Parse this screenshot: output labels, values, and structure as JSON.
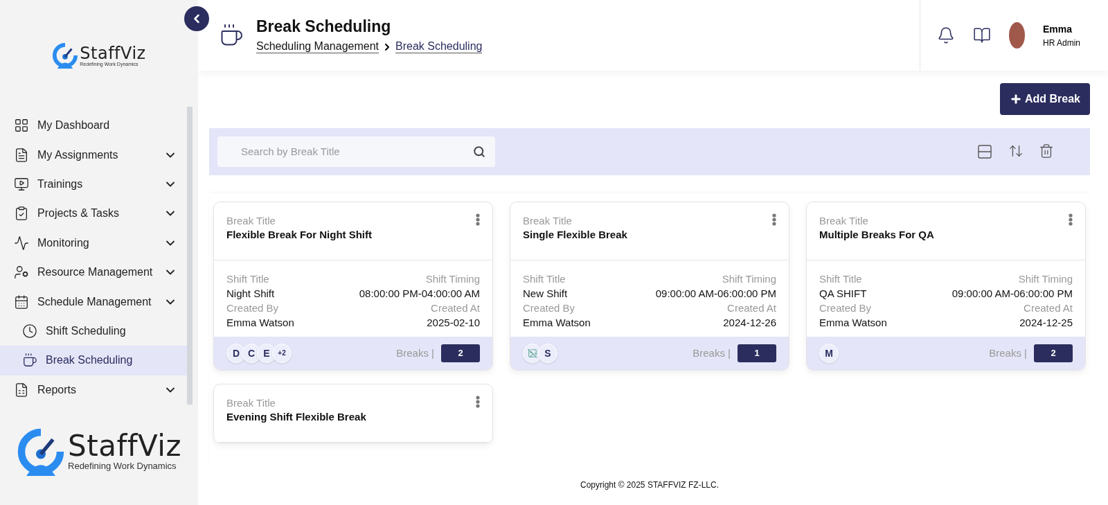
{
  "sidebar": {
    "logo": {
      "name": "StaffViz",
      "tagline": "Redefining Work Dynamics"
    },
    "items": [
      {
        "label": "My Dashboard",
        "expandable": false,
        "selected": false
      },
      {
        "label": "My Assignments",
        "expandable": true,
        "selected": false
      },
      {
        "label": "Trainings",
        "expandable": true,
        "selected": false
      },
      {
        "label": "Projects & Tasks",
        "expandable": true,
        "selected": false
      },
      {
        "label": "Monitoring",
        "expandable": true,
        "selected": false
      },
      {
        "label": "Resource Management",
        "expandable": true,
        "selected": false
      },
      {
        "label": "Schedule Management",
        "expandable": true,
        "selected": false,
        "children": [
          {
            "label": "Shift Scheduling",
            "selected": false
          },
          {
            "label": "Break Scheduling",
            "selected": true
          }
        ]
      },
      {
        "label": "Reports",
        "expandable": true,
        "selected": false
      }
    ],
    "footer_logo": {
      "name": "StaffViz",
      "tagline": "Redefining Work Dynamics"
    }
  },
  "header": {
    "title": "Break Scheduling",
    "breadcrumb": [
      "Scheduling Management",
      "Break Scheduling"
    ],
    "user": {
      "name": "Emma",
      "role": "HR Admin"
    }
  },
  "toolbar": {
    "add_button": "Add Break",
    "search": {
      "placeholder": "Search by Break Title"
    }
  },
  "cards": [
    {
      "title_label": "Break Title",
      "title": "Flexible Break For Night Shift",
      "shift_title_label": "Shift Title",
      "shift_title": "Night Shift",
      "timing_label": "Shift Timing",
      "timing": "08:00:00 PM-04:00:00 AM",
      "created_by_label": "Created By",
      "created_by": "Emma Watson",
      "created_at_label": "Created At",
      "created_at": "2025-02-10",
      "avatars": [
        {
          "kind": "initial",
          "text": "D"
        },
        {
          "kind": "initial",
          "text": "C"
        },
        {
          "kind": "initial",
          "text": "E"
        },
        {
          "kind": "more",
          "text": "+2"
        }
      ],
      "breaks_label": "Breaks |",
      "breaks": "2"
    },
    {
      "title_label": "Break Title",
      "title": "Single Flexible Break",
      "shift_title_label": "Shift Title",
      "shift_title": "New Shift",
      "timing_label": "Shift Timing",
      "timing": "09:00:00 AM-06:00:00 PM",
      "created_by_label": "Created By",
      "created_by": "Emma Watson",
      "created_at_label": "Created At",
      "created_at": "2024-12-26",
      "avatars": [
        {
          "kind": "broken-image"
        },
        {
          "kind": "initial",
          "text": "S"
        }
      ],
      "breaks_label": "Breaks |",
      "breaks": "1"
    },
    {
      "title_label": "Break Title",
      "title": "Multiple Breaks For QA",
      "shift_title_label": "Shift Title",
      "shift_title": "QA SHIFT",
      "timing_label": "Shift Timing",
      "timing": "09:00:00 AM-06:00:00 PM",
      "created_by_label": "Created By",
      "created_by": "Emma Watson",
      "created_at_label": "Created At",
      "created_at": "2024-12-25",
      "avatars": [
        {
          "kind": "initial",
          "text": "M"
        }
      ],
      "breaks_label": "Breaks |",
      "breaks": "2"
    },
    {
      "title_label": "Break Title",
      "title": "Evening Shift Flexible Break"
    }
  ],
  "footer": {
    "copyright": "Copyright © 2025 STAFFVIZ FZ-LLC."
  }
}
